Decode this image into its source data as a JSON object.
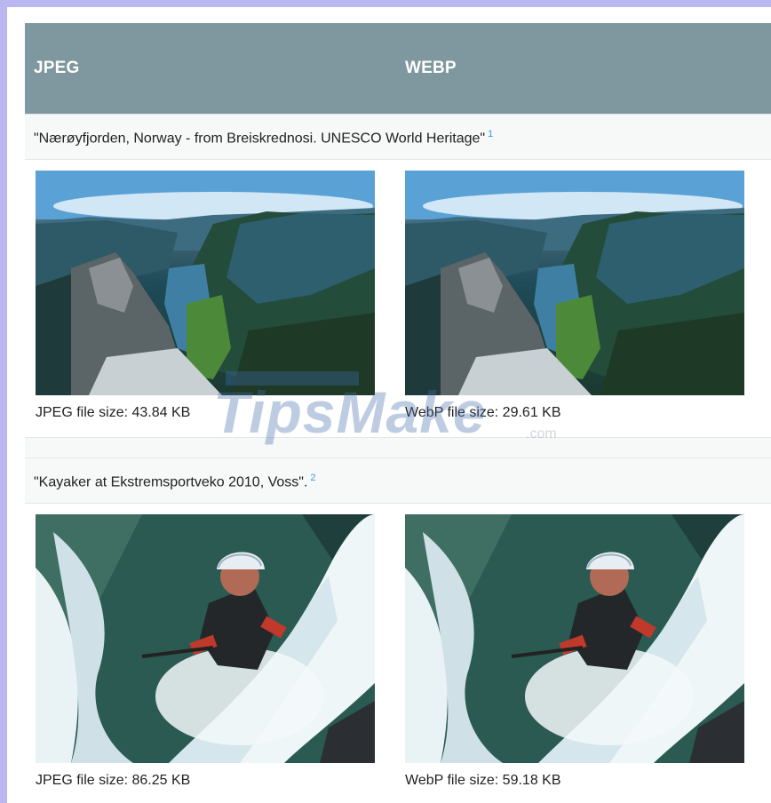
{
  "table": {
    "header": {
      "col1": "JPEG",
      "col2": "WEBP"
    },
    "rows": [
      {
        "caption": "\"Nærøyfjorden, Norway - from Breiskrednosi. UNESCO World Heritage\"",
        "footnote": "1",
        "jpeg_size_label": "JPEG file size: 43.84 KB",
        "webp_size_label": "WebP file size: 29.61 KB"
      },
      {
        "caption": "\"Kayaker at Ekstremsportveko 2010, Voss\".",
        "footnote": "2",
        "jpeg_size_label": "JPEG file size: 86.25 KB",
        "webp_size_label": "WebP file size: 59.18 KB"
      }
    ]
  },
  "watermark": {
    "text": "TipsMake",
    "suffix": ".com"
  },
  "colors": {
    "header_bg": "#7f979e",
    "header_text": "#ffffff",
    "footnote": "#2f9fd8",
    "frame": "#b9b6f0"
  }
}
